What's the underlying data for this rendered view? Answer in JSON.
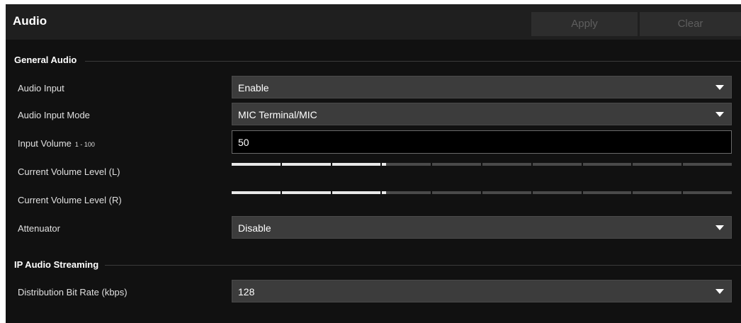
{
  "header": {
    "title": "Audio",
    "apply_label": "Apply",
    "clear_label": "Clear"
  },
  "general_audio": {
    "section_title": "General Audio",
    "audio_input": {
      "label": "Audio Input",
      "value": "Enable"
    },
    "audio_input_mode": {
      "label": "Audio Input Mode",
      "value": "MIC Terminal/MIC"
    },
    "input_volume": {
      "label": "Input Volume",
      "range": "1 - 100",
      "value": "50"
    },
    "level_left": {
      "label": "Current Volume Level (L)",
      "segments_total": 10,
      "segments_lit": 3
    },
    "level_right": {
      "label": "Current Volume Level (R)",
      "segments_total": 10,
      "segments_lit": 3
    },
    "attenuator": {
      "label": "Attenuator",
      "value": "Disable"
    }
  },
  "ip_audio_streaming": {
    "section_title": "IP Audio Streaming",
    "bit_rate": {
      "label": "Distribution Bit Rate (kbps)",
      "value": "128"
    }
  },
  "colors": {
    "panel_bg": "#111111",
    "header_bg": "#1f1f1f",
    "select_bg": "#3c3c3c",
    "meter_lit": "#e8e8e8",
    "meter_unlit": "#4a4a4a"
  },
  "icons": {
    "dropdown": "caret-down-icon"
  }
}
